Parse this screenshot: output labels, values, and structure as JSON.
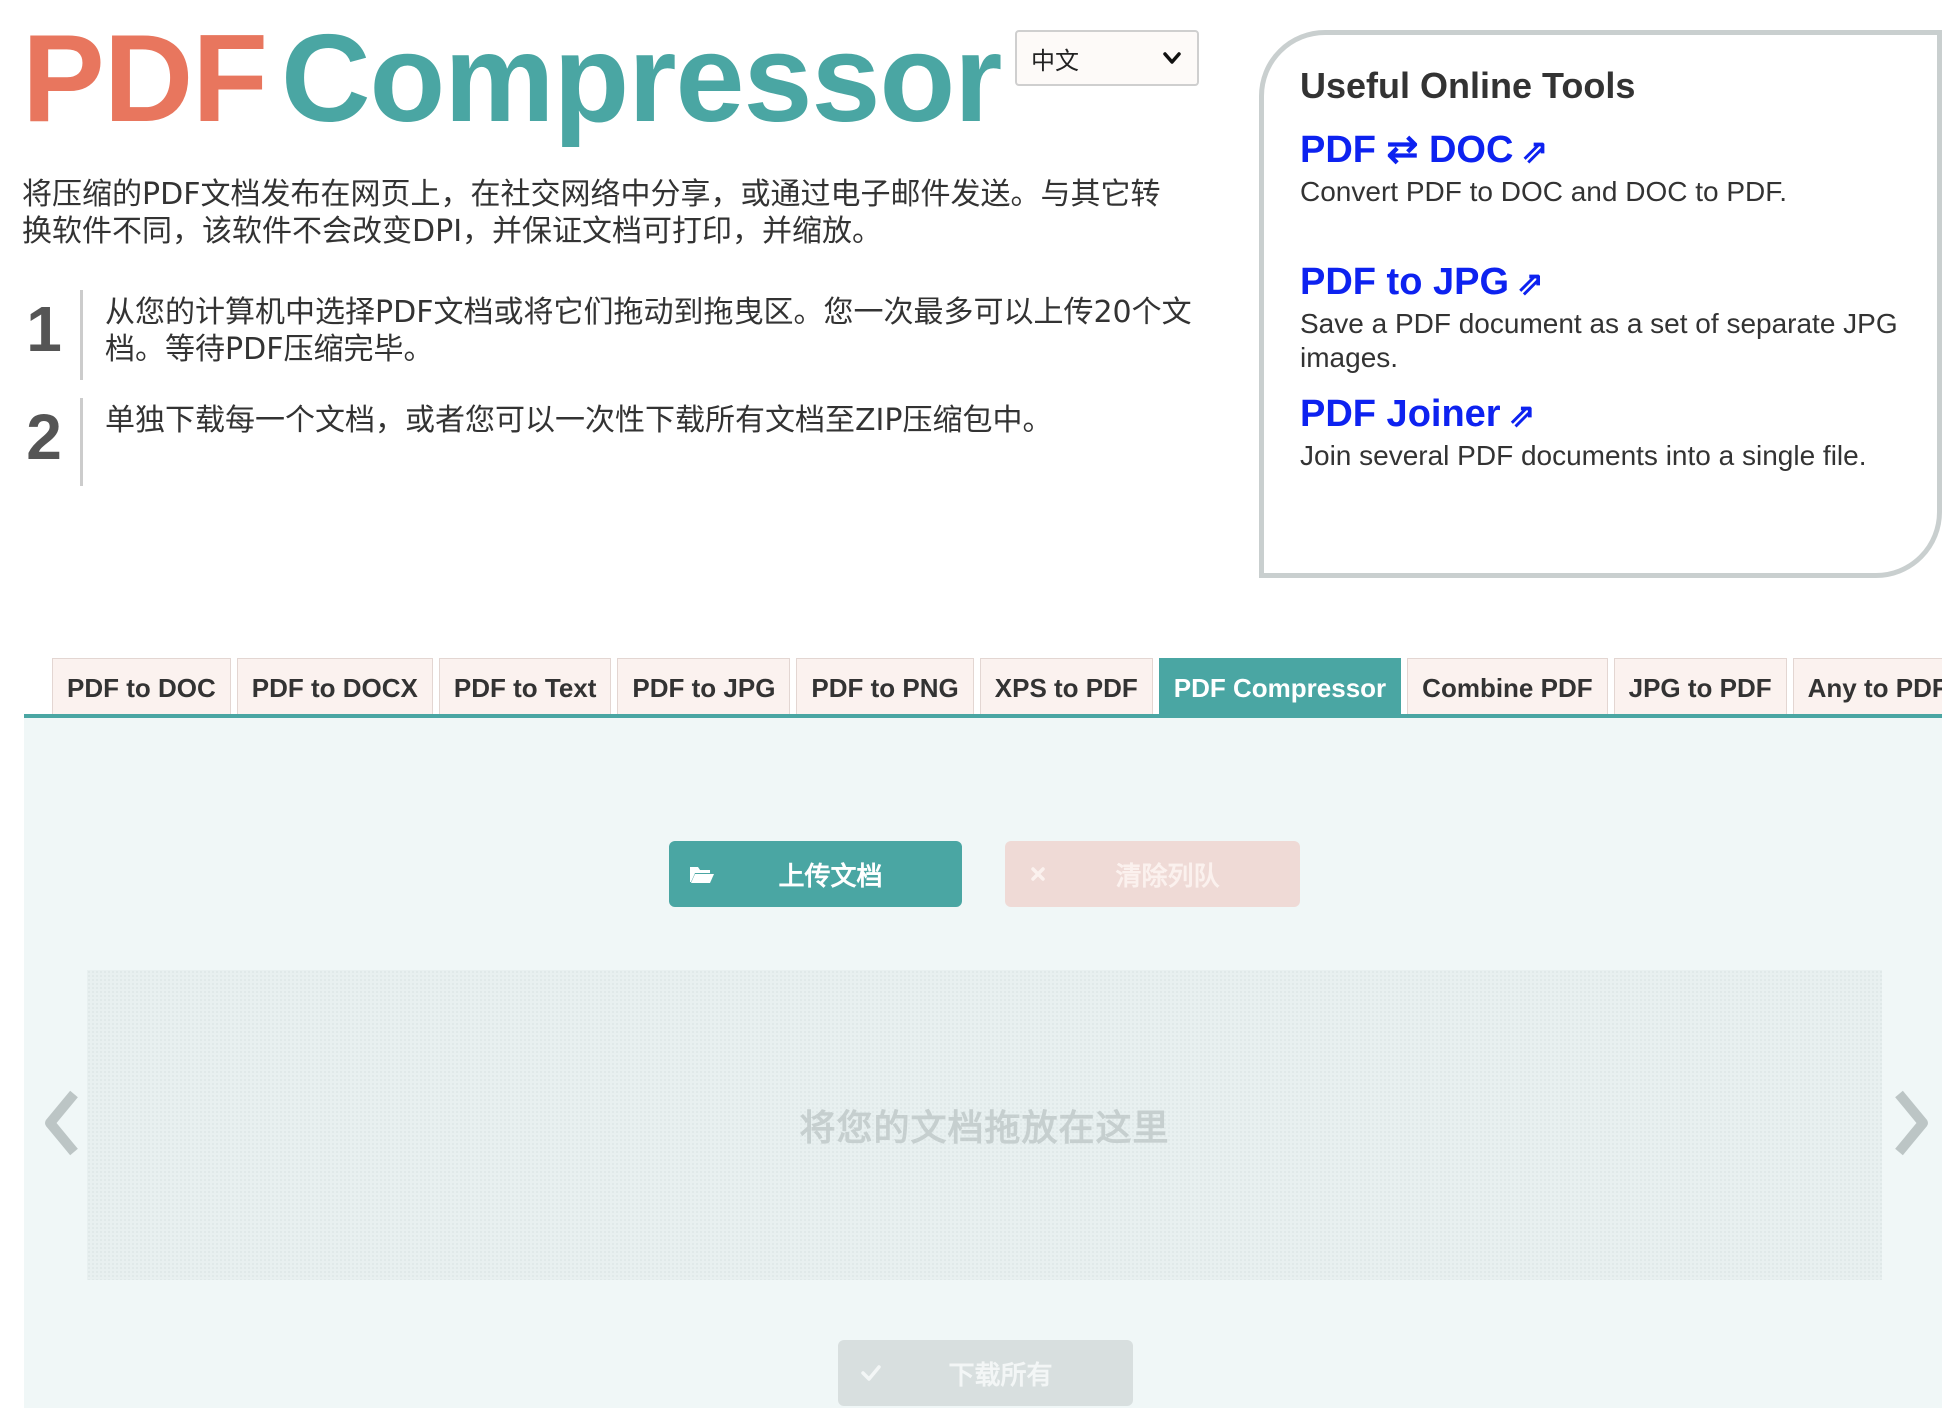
{
  "header": {
    "logo_part1": "PDF",
    "logo_part2": "Compressor",
    "language": "中文"
  },
  "intro": {
    "text": "将压缩的PDF文档发布在网页上，在社交网络中分享，或通过电子邮件发送。与其它转换软件不同，该软件不会改变DPI，并保证文档可打印，并缩放。",
    "steps": [
      {
        "number": "1",
        "text": "从您的计算机中选择PDF文档或将它们拖动到拖曳区。您一次最多可以上传20个文档。等待PDF压缩完毕。"
      },
      {
        "number": "2",
        "text": "单独下载每一个文档，或者您可以一次性下载所有文档至ZIP压缩包中。"
      }
    ]
  },
  "tools": {
    "title": "Useful Online Tools",
    "items": [
      {
        "label": "PDF ⇄ DOC",
        "arrow": "⇗",
        "desc": "Convert PDF to DOC and DOC to PDF."
      },
      {
        "label": "PDF to JPG",
        "arrow": "⇗",
        "desc": "Save a PDF document as a set of separate JPG images."
      },
      {
        "label": "PDF Joiner",
        "arrow": "⇗",
        "desc": "Join several PDF documents into a single file."
      }
    ]
  },
  "tabs": [
    {
      "label": "PDF to DOC",
      "active": false
    },
    {
      "label": "PDF to DOCX",
      "active": false
    },
    {
      "label": "PDF to Text",
      "active": false
    },
    {
      "label": "PDF to JPG",
      "active": false
    },
    {
      "label": "PDF to PNG",
      "active": false
    },
    {
      "label": "XPS to PDF",
      "active": false
    },
    {
      "label": "PDF Compressor",
      "active": true
    },
    {
      "label": "Combine PDF",
      "active": false
    },
    {
      "label": "JPG to PDF",
      "active": false
    },
    {
      "label": "Any to PDF",
      "active": false
    }
  ],
  "actions": {
    "upload_label": "上传文档",
    "upload_icon": "folder-open-icon",
    "clear_label": "清除列队",
    "clear_icon": "close-icon",
    "download_label": "下载所有",
    "download_icon": "checkmark-icon"
  },
  "dropzone": {
    "text": "将您的文档拖放在这里"
  },
  "colors": {
    "brand_teal": "#4aa6a3",
    "brand_salmon": "#e8765e",
    "link_blue": "#0d22f0",
    "panel_bg": "#f0f7f7"
  }
}
